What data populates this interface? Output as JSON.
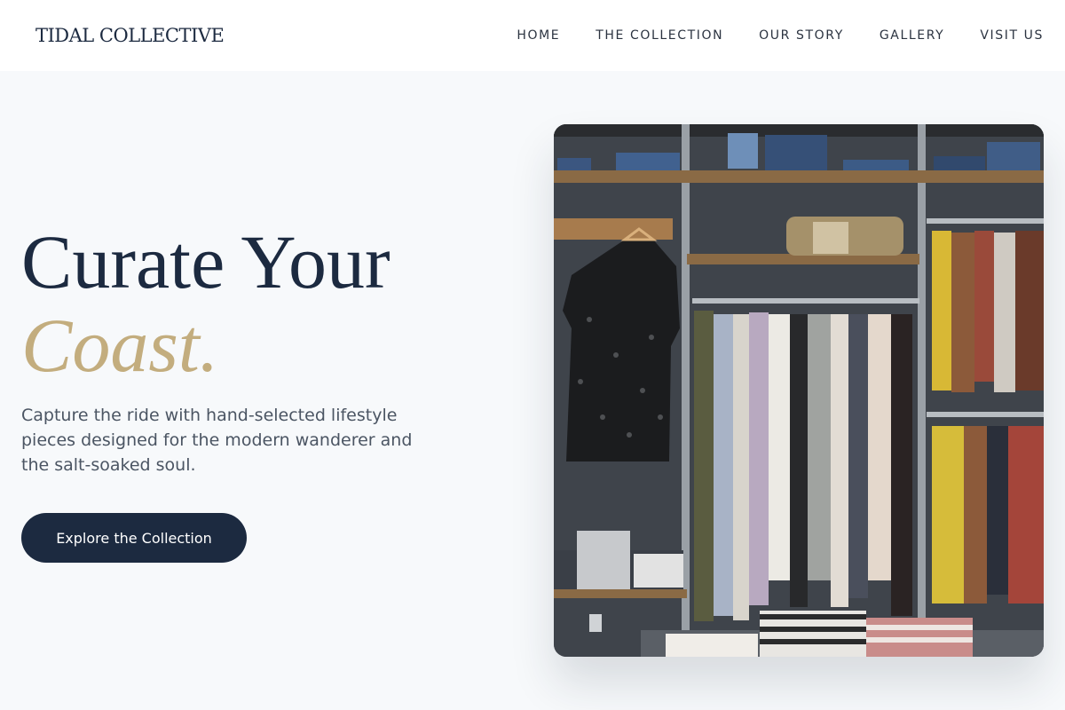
{
  "brand": {
    "logo": "TIDAL COLLECTIVE"
  },
  "nav": {
    "items": [
      "HOME",
      "THE COLLECTION",
      "OUR STORY",
      "GALLERY",
      "VISIT US"
    ]
  },
  "hero": {
    "headline_line1": "Curate Your",
    "headline_line2": "Coast.",
    "lede": "Capture the ride with hand-selected lifestyle pieces designed for the modern wanderer and the salt-soaked soul.",
    "cta_label": "Explore the Collection"
  },
  "colors": {
    "navy": "#1c2a40",
    "gold": "#c3ad7e",
    "background": "#f7f9fb"
  }
}
